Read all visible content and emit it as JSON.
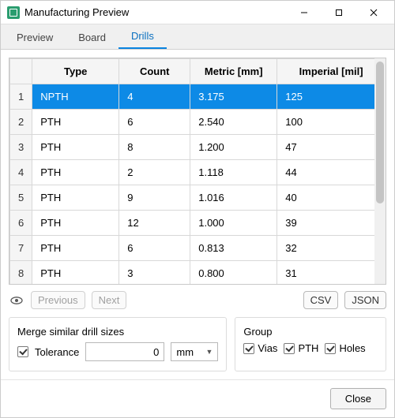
{
  "window": {
    "title": "Manufacturing Preview",
    "buttons": {
      "minimize": "—",
      "maximize": "▢",
      "close": "✕"
    }
  },
  "tabs": {
    "items": [
      "Preview",
      "Board",
      "Drills"
    ],
    "active_index": 2
  },
  "table": {
    "headers": {
      "type": "Type",
      "count": "Count",
      "metric": "Metric [mm]",
      "imperial": "Imperial [mil]"
    },
    "rows": [
      {
        "n": "1",
        "type": "NPTH",
        "count": "4",
        "metric": "3.175",
        "imperial": "125",
        "selected": true
      },
      {
        "n": "2",
        "type": "PTH",
        "count": "6",
        "metric": "2.540",
        "imperial": "100"
      },
      {
        "n": "3",
        "type": "PTH",
        "count": "8",
        "metric": "1.200",
        "imperial": "47"
      },
      {
        "n": "4",
        "type": "PTH",
        "count": "2",
        "metric": "1.118",
        "imperial": "44"
      },
      {
        "n": "5",
        "type": "PTH",
        "count": "9",
        "metric": "1.016",
        "imperial": "40"
      },
      {
        "n": "6",
        "type": "PTH",
        "count": "12",
        "metric": "1.000",
        "imperial": "39"
      },
      {
        "n": "7",
        "type": "PTH",
        "count": "6",
        "metric": "0.813",
        "imperial": "32"
      },
      {
        "n": "8",
        "type": "PTH",
        "count": "3",
        "metric": "0.800",
        "imperial": "31"
      }
    ]
  },
  "nav": {
    "previous": "Previous",
    "next": "Next",
    "csv": "CSV",
    "json": "JSON"
  },
  "merge_box": {
    "legend": "Merge similar drill sizes",
    "tolerance_label": "Tolerance",
    "tolerance_value": "0",
    "unit_value": "mm",
    "tolerance_checked": true
  },
  "group_box": {
    "legend": "Group",
    "items": [
      {
        "label": "Vias",
        "checked": true
      },
      {
        "label": "PTH",
        "checked": true
      },
      {
        "label": "Holes",
        "checked": true
      }
    ]
  },
  "footer": {
    "close": "Close"
  }
}
